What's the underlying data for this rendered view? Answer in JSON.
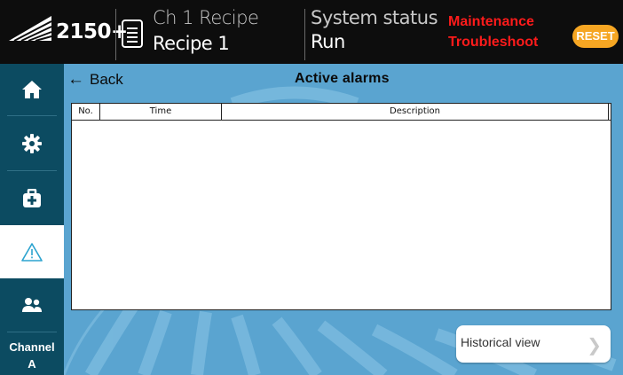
{
  "header": {
    "model": "2150+",
    "recipe_heading": "Ch 1 Recipe",
    "recipe_name": "Recipe 1",
    "status_heading": "System status",
    "status_value": "Run",
    "mode_line1": "Maintenance",
    "mode_line2": "Troubleshoot",
    "reset_label": "RESET"
  },
  "sidebar": {
    "items": [
      {
        "icon": "home-icon"
      },
      {
        "icon": "gear-icon"
      },
      {
        "icon": "toolbox-icon"
      },
      {
        "icon": "warning-icon",
        "active": true
      },
      {
        "icon": "users-icon"
      }
    ],
    "channel_label": "Channel",
    "channel_value": "A"
  },
  "main": {
    "back_label": "Back",
    "title": "Active alarms",
    "table": {
      "columns": [
        "No.",
        "Time",
        "Description"
      ],
      "rows": []
    },
    "historical_label": "Historical view"
  },
  "colors": {
    "sidebar": "#0c4b61",
    "main_bg": "#5aa4d0",
    "alert_text": "#ff1b1b",
    "reset": "#f6a623"
  }
}
